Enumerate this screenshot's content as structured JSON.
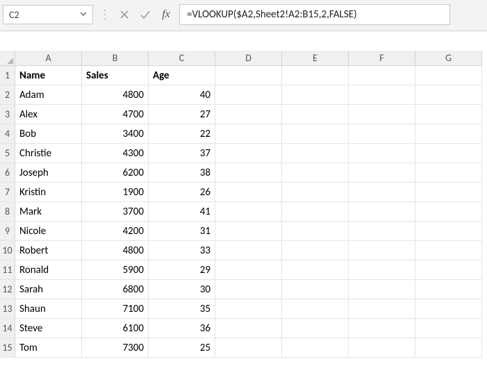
{
  "name_box": "C2",
  "formula": "=VLOOKUP($A2,Sheet2!A2:B15,2,FALSE)",
  "columns": [
    "A",
    "B",
    "C",
    "D",
    "E",
    "F",
    "G"
  ],
  "headers": {
    "c0": "Name",
    "c1": "Sales",
    "c2": "Age"
  },
  "rows": [
    {
      "n": "1"
    },
    {
      "n": "2",
      "name": "Adam",
      "sales": "4800",
      "age": "40"
    },
    {
      "n": "3",
      "name": "Alex",
      "sales": "4700",
      "age": "27"
    },
    {
      "n": "4",
      "name": "Bob",
      "sales": "3400",
      "age": "22"
    },
    {
      "n": "5",
      "name": "Christie",
      "sales": "4300",
      "age": "37"
    },
    {
      "n": "6",
      "name": "Joseph",
      "sales": "6200",
      "age": "38"
    },
    {
      "n": "7",
      "name": "Kristin",
      "sales": "1900",
      "age": "26"
    },
    {
      "n": "8",
      "name": "Mark",
      "sales": "3700",
      "age": "41"
    },
    {
      "n": "9",
      "name": "Nicole",
      "sales": "4200",
      "age": "31"
    },
    {
      "n": "10",
      "name": "Robert",
      "sales": "4800",
      "age": "33"
    },
    {
      "n": "11",
      "name": "Ronald",
      "sales": "5900",
      "age": "29"
    },
    {
      "n": "12",
      "name": "Sarah",
      "sales": "6800",
      "age": "30"
    },
    {
      "n": "13",
      "name": "Shaun",
      "sales": "7100",
      "age": "35"
    },
    {
      "n": "14",
      "name": "Steve",
      "sales": "6100",
      "age": "36"
    },
    {
      "n": "15",
      "name": "Tom",
      "sales": "7300",
      "age": "25"
    }
  ]
}
